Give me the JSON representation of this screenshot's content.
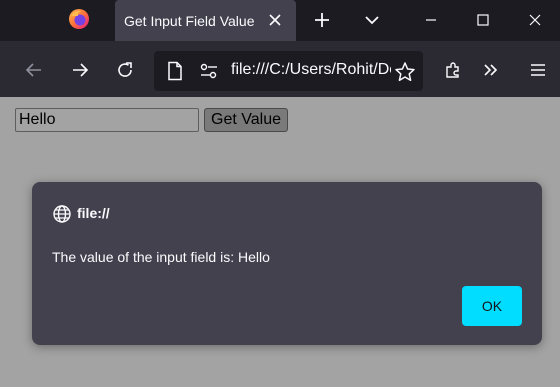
{
  "browser": {
    "tab_title": "Get Input Field Value",
    "url": "file:///C:/Users/Rohit/Desktop/index.html"
  },
  "page": {
    "input_value": "Hello",
    "button_label": "Get Value"
  },
  "dialog": {
    "origin": "file://",
    "message": "The value of the input field is: Hello",
    "ok_label": "OK"
  },
  "colors": {
    "accent": "#00ddff",
    "tabbar": "#1c1b22",
    "toolbar": "#2b2a33",
    "dialog": "#42414d"
  },
  "icons": [
    "firefox-logo",
    "close-icon",
    "plus-icon",
    "chevron-down-icon",
    "minimize-icon",
    "maximize-icon",
    "window-close-icon",
    "back-arrow-icon",
    "forward-arrow-icon",
    "reload-icon",
    "page-icon",
    "permissions-icon",
    "star-icon",
    "extensions-icon",
    "overflow-icon",
    "menu-icon",
    "globe-icon"
  ]
}
